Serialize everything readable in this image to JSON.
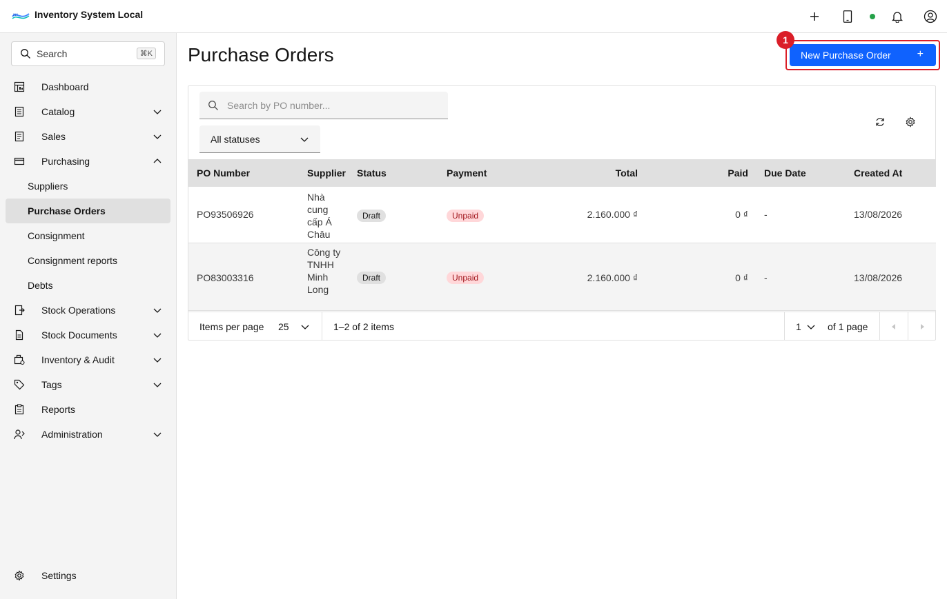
{
  "app": {
    "title": "Inventory System Local"
  },
  "sidebar": {
    "search_label": "Search",
    "search_shortcut": "⌘K",
    "items": [
      {
        "label": "Dashboard",
        "icon": "dashboard-icon",
        "expandable": false
      },
      {
        "label": "Catalog",
        "icon": "catalog-icon",
        "expandable": true
      },
      {
        "label": "Sales",
        "icon": "sales-icon",
        "expandable": true
      },
      {
        "label": "Purchasing",
        "icon": "purchasing-icon",
        "expandable": true,
        "expanded": true
      },
      {
        "label": "Stock Operations",
        "icon": "stock-operations-icon",
        "expandable": true
      },
      {
        "label": "Stock Documents",
        "icon": "stock-documents-icon",
        "expandable": true
      },
      {
        "label": "Inventory & Audit",
        "icon": "inventory-audit-icon",
        "expandable": true
      },
      {
        "label": "Tags",
        "icon": "tag-icon",
        "expandable": true
      },
      {
        "label": "Reports",
        "icon": "reports-icon",
        "expandable": false
      },
      {
        "label": "Administration",
        "icon": "administration-icon",
        "expandable": true
      }
    ],
    "purchasing_sub": [
      "Suppliers",
      "Purchase Orders",
      "Consignment",
      "Consignment reports",
      "Debts"
    ],
    "active_sub": "Purchase Orders",
    "settings_label": "Settings"
  },
  "main": {
    "page_title": "Purchase Orders",
    "new_button_label": "New Purchase Order",
    "new_button_plus": "+",
    "step_badge": "1",
    "search_placeholder": "Search by PO number...",
    "status_filter": "All statuses",
    "columns": [
      "PO Number",
      "Supplier",
      "Status",
      "Payment",
      "Total",
      "Paid",
      "Due Date",
      "Created At"
    ],
    "rows": [
      {
        "po_number": "PO93506926",
        "supplier": "Nhà cung cấp Á Châu",
        "status": "Draft",
        "payment": "Unpaid",
        "total": "2.160.000 ₫",
        "paid": "0 ₫",
        "due_date": "-",
        "created_at": "13/08/2026"
      },
      {
        "po_number": "PO83003316",
        "supplier": "Công ty TNHH Minh Long",
        "status": "Draft",
        "payment": "Unpaid",
        "total": "2.160.000 ₫",
        "paid": "0 ₫",
        "due_date": "-",
        "created_at": "13/08/2026"
      }
    ],
    "pagination": {
      "items_per_page_label": "Items per page",
      "items_per_page": "25",
      "range_text": "1–2 of 2 items",
      "current_page": "1",
      "total_pages_text": "of 1 page"
    }
  },
  "colors": {
    "primary": "#0f62fe",
    "highlight": "#da1e28",
    "online": "#24a148"
  }
}
